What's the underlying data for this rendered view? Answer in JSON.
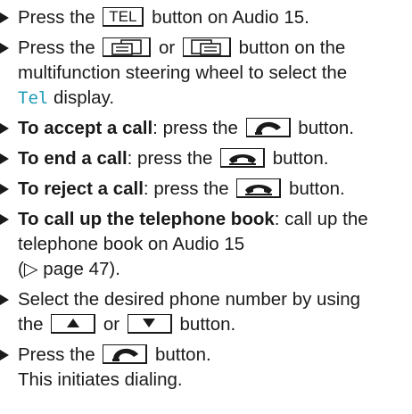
{
  "colors": {
    "accent": "#1f9bb8",
    "text": "#1a1a1a"
  },
  "items": [
    {
      "pre": "Press the ",
      "key": "TEL",
      "post": " button on Audio 15."
    },
    {
      "l1a": "Press the ",
      "l1b": " or ",
      "l1c": " button on the",
      "l2": "multifunction steering wheel to select the",
      "l3tel": "Tel",
      "l3": " display."
    },
    {
      "bold": "To accept a call",
      "mid": ": press the ",
      "post": " button."
    },
    {
      "bold": "To end a call",
      "mid": ": press the ",
      "post": " button."
    },
    {
      "bold": "To reject a call",
      "mid": ": press the ",
      "post": " button."
    },
    {
      "bold": "To call up the telephone book",
      "mid": ": call up the",
      "l2": "telephone book on Audio 15",
      "l3": "(▷ page 47)."
    },
    {
      "l1": "Select the desired phone number by using",
      "l2a": "the ",
      "l2b": " or ",
      "l2c": " button."
    },
    {
      "l1a": "Press the ",
      "l1b": " button.",
      "l2": "This initiates dialing."
    }
  ],
  "icons": {
    "phone_accept": "phone-accept-icon",
    "phone_end": "phone-end-icon",
    "display_prev": "display-prev-icon",
    "display_next": "display-next-icon",
    "arrow_up": "arrow-up-icon",
    "arrow_down": "arrow-down-icon"
  }
}
